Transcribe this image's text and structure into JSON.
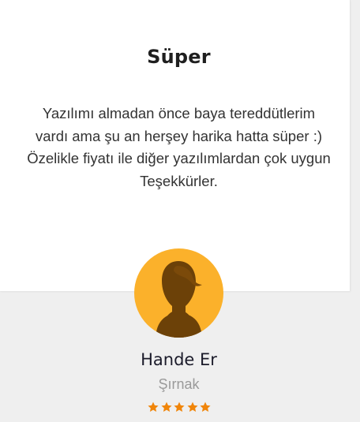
{
  "review": {
    "title": "Süper",
    "lines": [
      "Yazılımı almadan önce baya tereddütlerim",
      "vardı ama şu an herşey harika hatta süper :)",
      "Özelikle fiyatı ile diğer yazılımlardan çok uygun",
      "Teşekkürler."
    ]
  },
  "reviewer": {
    "name": "Hande Er",
    "city": "Şırnak",
    "avatar_icon": "user-silhouette-icon",
    "avatar_color": "#fbb12b"
  },
  "rating": {
    "value": 5,
    "max": 5,
    "icon": "star-icon",
    "color": "#f0850a"
  }
}
